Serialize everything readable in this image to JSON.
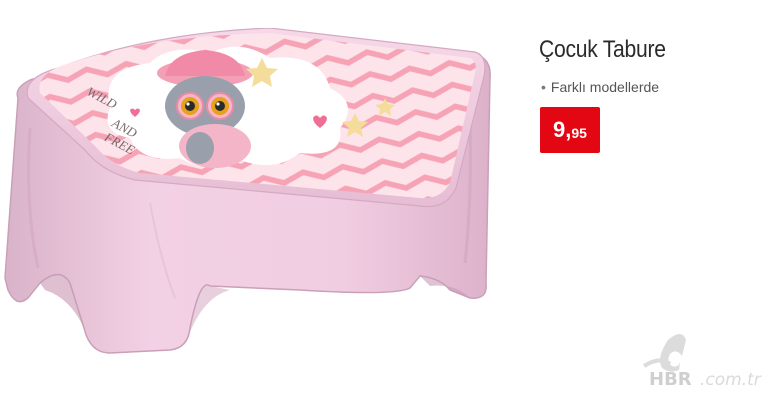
{
  "product": {
    "title": "Çocuk Tabure",
    "feature": "Farklı modellerde",
    "bullet": "•",
    "price": {
      "integer": "9",
      "separator": ",",
      "decimals": "95"
    },
    "print_text": {
      "line1": "WILD",
      "line2": "AND",
      "line3": "FREE"
    }
  },
  "watermark": {
    "logo_text": "aHBR.com.tr"
  },
  "colors": {
    "price_background": "#e30613",
    "stool_pink": "#f3cde0",
    "print_stripe": "#f7a3b6"
  }
}
